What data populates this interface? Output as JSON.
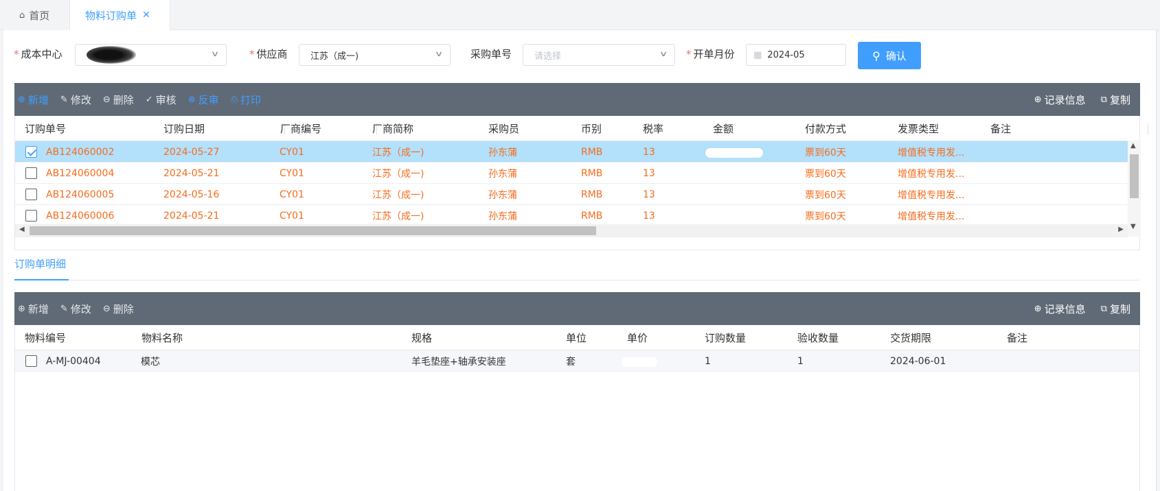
{
  "tabs": [
    {
      "label": "首页",
      "icon": "home-icon"
    },
    {
      "label": "物料订购单",
      "icon": "close-icon"
    }
  ],
  "form": {
    "cost_center": {
      "label": "成本中心",
      "value": ""
    },
    "supplier": {
      "label": "供应商",
      "value": "江苏（成一)"
    },
    "po_no": {
      "label": "采购单号",
      "placeholder": "请选择"
    },
    "month": {
      "label": "开单月份",
      "value": "2024-05"
    },
    "confirm_label": "确认",
    "required_mark": "*"
  },
  "toolbar1": {
    "add": "新增",
    "edit": "修改",
    "delete": "删除",
    "audit": "审核",
    "unaudit": "反审",
    "print": "打印",
    "record_info": "记录信息",
    "copy": "复制"
  },
  "orders": {
    "columns": [
      "订购单号",
      "订购日期",
      "厂商编号",
      "厂商简称",
      "采购员",
      "币别",
      "税率",
      "金额",
      "付款方式",
      "发票类型",
      "备注"
    ],
    "rows": [
      {
        "checked": true,
        "no": "AB124060002",
        "date": "2024-05-27",
        "vendor_code": "CY01",
        "vendor": "江苏（成一)",
        "buyer": "孙东蒲",
        "currency": "RMB",
        "tax": "13",
        "amount": "",
        "payment": "票到60天",
        "invoice": "增值税专用发...",
        "remark": ""
      },
      {
        "checked": false,
        "no": "AB124060004",
        "date": "2024-05-21",
        "vendor_code": "CY01",
        "vendor": "江苏（成一)",
        "buyer": "孙东蒲",
        "currency": "RMB",
        "tax": "13",
        "amount": "",
        "payment": "票到60天",
        "invoice": "增值税专用发...",
        "remark": ""
      },
      {
        "checked": false,
        "no": "AB124060005",
        "date": "2024-05-16",
        "vendor_code": "CY01",
        "vendor": "江苏（成一)",
        "buyer": "孙东蒲",
        "currency": "RMB",
        "tax": "13",
        "amount": "",
        "payment": "票到60天",
        "invoice": "增值税专用发...",
        "remark": ""
      },
      {
        "checked": false,
        "no": "AB124060006",
        "date": "2024-05-21",
        "vendor_code": "CY01",
        "vendor": "江苏（成一)",
        "buyer": "孙东蒲",
        "currency": "RMB",
        "tax": "13",
        "amount": "",
        "payment": "票到60天",
        "invoice": "增值税专用发...",
        "remark": ""
      }
    ]
  },
  "detail_tab": "订购单明细",
  "toolbar2": {
    "add": "新增",
    "edit": "修改",
    "delete": "删除",
    "record_info": "记录信息",
    "copy": "复制"
  },
  "details": {
    "columns": [
      "物料编号",
      "物料名称",
      "规格",
      "单位",
      "单价",
      "订购数量",
      "验收数量",
      "交货期限",
      "备注"
    ],
    "rows": [
      {
        "code": "A-MJ-00404",
        "name": "模芯",
        "spec": "羊毛垫座+轴承安装座",
        "unit": "套",
        "price": "",
        "qty": "1",
        "recv": "1",
        "due": "2024-06-01",
        "remark": ""
      }
    ]
  },
  "colors": {
    "accent": "#409eff",
    "toolbar": "#5f6a76",
    "row_text": "#f56c1d",
    "selected_row": "#b3e0fb"
  }
}
